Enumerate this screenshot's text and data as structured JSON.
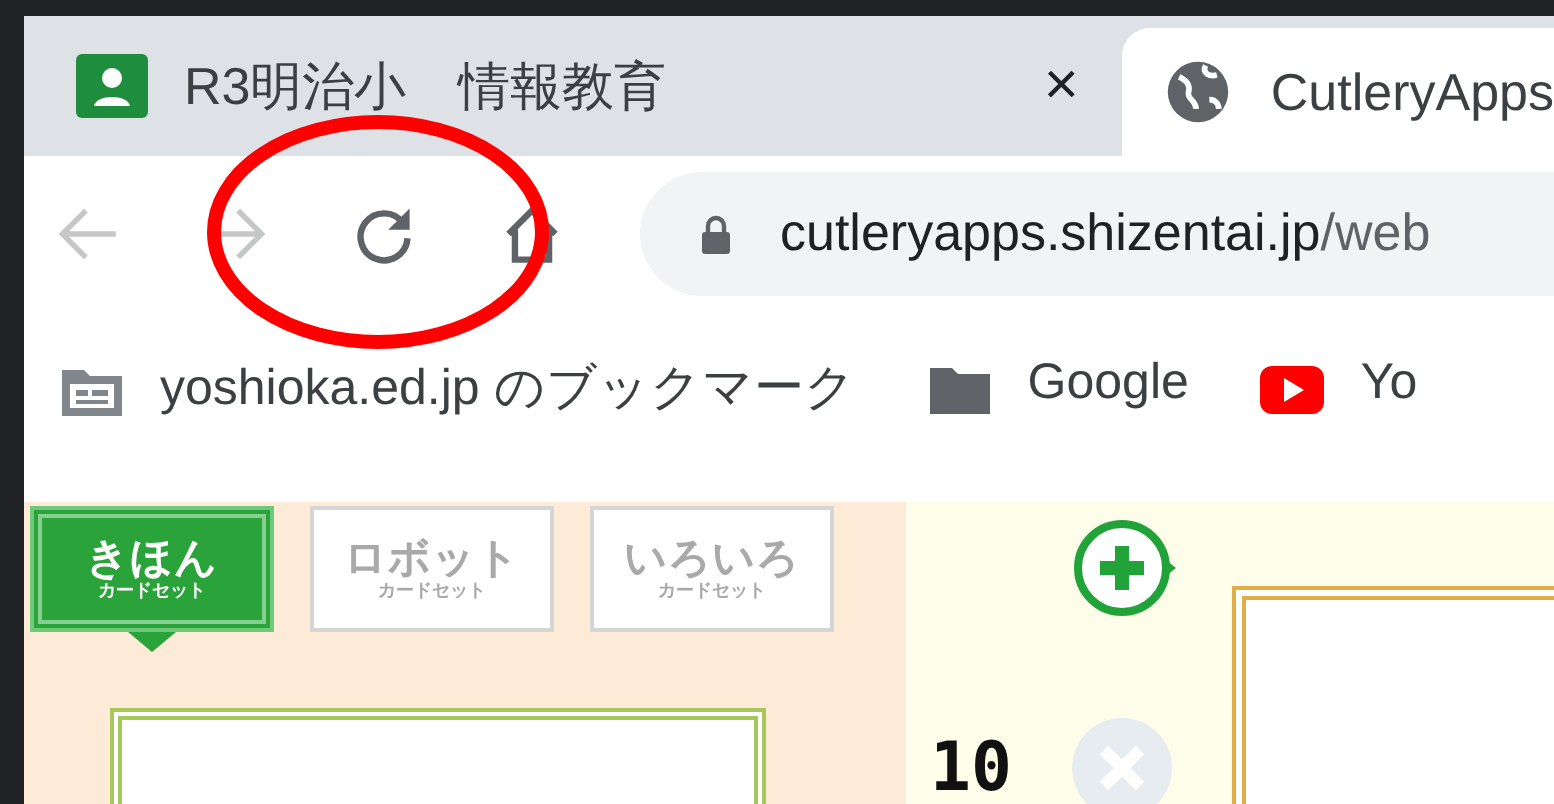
{
  "tabs": [
    {
      "title": "R3明治小　情報教育",
      "kind": "classroom",
      "selected": false,
      "close": "×"
    },
    {
      "title": "CutleryApps",
      "kind": "site",
      "selected": true
    }
  ],
  "toolbar": {
    "nav": [
      {
        "kind": "back",
        "disabled": true
      },
      {
        "kind": "forward",
        "disabled": true
      },
      {
        "kind": "reload",
        "disabled": false
      },
      {
        "kind": "home",
        "disabled": false
      }
    ],
    "url_host": "cutleryapps.shizentai.jp",
    "url_path": "/web"
  },
  "bookmarks": [
    {
      "kind": "managed",
      "label": "yoshioka.ed.jp のブックマーク"
    },
    {
      "kind": "folder",
      "label": "Google"
    },
    {
      "kind": "youtube",
      "label": "Yo"
    }
  ],
  "card_sets": [
    {
      "title": "きほん",
      "subtitle": "カードセット",
      "selected": true
    },
    {
      "title": "ロボット",
      "subtitle": "カードセット",
      "selected": false
    },
    {
      "title": "いろいろ",
      "subtitle": "カードセット",
      "selected": false
    }
  ],
  "counter": "10"
}
